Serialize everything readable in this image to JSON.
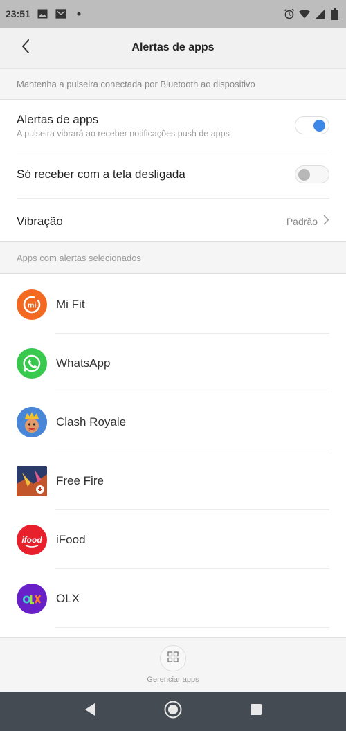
{
  "status_bar": {
    "time": "23:51",
    "left_icons": [
      "image-icon",
      "mail-icon",
      "dot-icon"
    ],
    "right_icons": [
      "alarm-icon",
      "wifi-icon",
      "signal-icon",
      "battery-icon"
    ]
  },
  "header": {
    "title": "Alertas de apps",
    "back_icon": "chevron-left-icon"
  },
  "info_bar": {
    "text": "Mantenha a pulseira conectada por Bluetooth ao dispositivo"
  },
  "settings": {
    "app_alerts": {
      "title": "Alertas de apps",
      "subtitle": "A pulseira vibrará ao receber notificações push de apps",
      "toggle_on": true
    },
    "screen_off": {
      "title": "Só receber com a tela desligada",
      "toggle_on": false
    },
    "vibration": {
      "title": "Vibração",
      "value": "Padrão"
    }
  },
  "apps_section": {
    "header": "Apps com alertas selecionados",
    "apps": [
      {
        "name": "Mi Fit",
        "icon": "mifit-icon",
        "color": "#f26a22"
      },
      {
        "name": "WhatsApp",
        "icon": "whatsapp-icon",
        "color": "#38c94e"
      },
      {
        "name": "Clash Royale",
        "icon": "clash-royale-icon",
        "color": "#3a6fc2"
      },
      {
        "name": "Free Fire",
        "icon": "free-fire-icon",
        "color": "#b54a2a"
      },
      {
        "name": "iFood",
        "icon": "ifood-icon",
        "color": "#e8202c"
      },
      {
        "name": "OLX",
        "icon": "olx-icon",
        "color": "#6a20c8"
      }
    ]
  },
  "bottom_bar": {
    "label": "Gerenciar apps",
    "icon": "grid-icon"
  },
  "nav_bar": {
    "icons": [
      "back-triangle-icon",
      "home-circle-icon",
      "recents-square-icon"
    ]
  },
  "colors": {
    "accent": "#3b88e6",
    "nav_bar": "#444b52",
    "status_bar": "#bdbdbd"
  }
}
